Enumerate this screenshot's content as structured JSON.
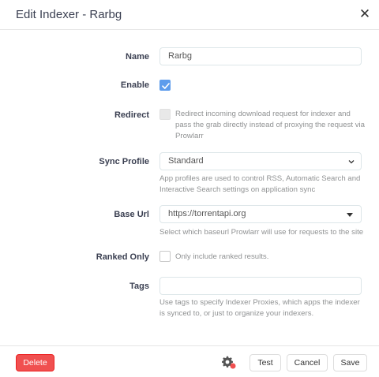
{
  "modal": {
    "title": "Edit Indexer - Rarbg",
    "close_icon": "close-icon"
  },
  "form": {
    "name": {
      "label": "Name",
      "value": "Rarbg"
    },
    "enable": {
      "label": "Enable",
      "checked": true
    },
    "redirect": {
      "label": "Redirect",
      "checked": false,
      "disabled": true,
      "help": "Redirect incoming download request for indexer and pass the grab directly instead of proxying the request via Prowlarr"
    },
    "sync_profile": {
      "label": "Sync Profile",
      "value": "Standard",
      "help": "App profiles are used to control RSS, Automatic Search and Interactive Search settings on application sync"
    },
    "base_url": {
      "label": "Base Url",
      "value": "https://torrentapi.org",
      "help": "Select which baseurl Prowlarr will use for requests to the site"
    },
    "ranked_only": {
      "label": "Ranked Only",
      "checked": false,
      "help": "Only include ranked results."
    },
    "tags": {
      "label": "Tags",
      "value": "",
      "help": "Use tags to specify Indexer Proxies, which apps the indexer is synced to, or just to organize your indexers."
    }
  },
  "footer": {
    "delete_label": "Delete",
    "advanced_icon": "gear-icon",
    "test_label": "Test",
    "cancel_label": "Cancel",
    "save_label": "Save"
  },
  "colors": {
    "danger": "#f05050",
    "primary": "#5d9cec",
    "advanced_badge": "#f05050"
  }
}
